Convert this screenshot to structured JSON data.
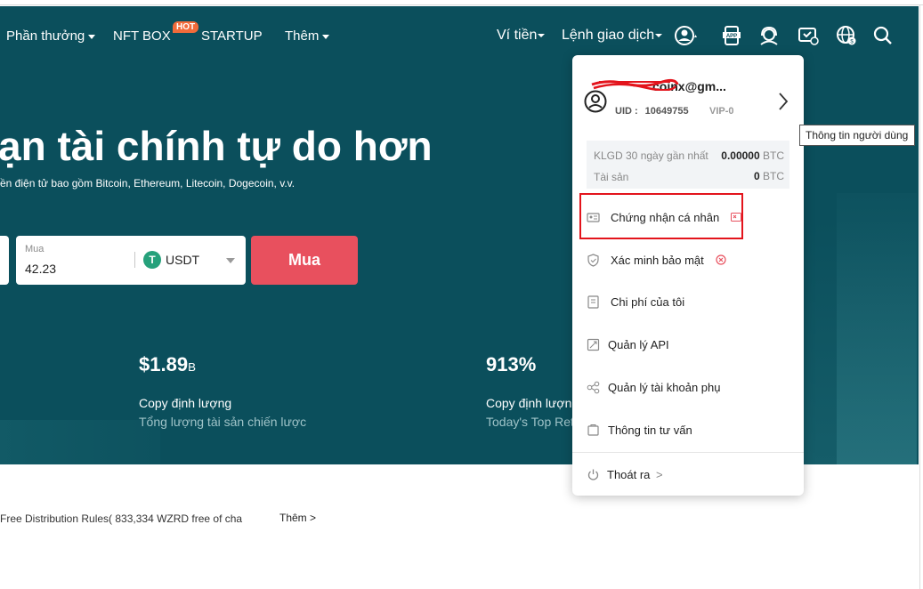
{
  "nav": {
    "rewards": "Phần thưởng",
    "nft_box": "NFT BOX",
    "hot_badge": "HOT",
    "startup": "STARTUP",
    "more": "Thêm",
    "wallet": "Ví tiền",
    "orders": "Lệnh giao dịch",
    "icons": [
      "user-icon",
      "app-icon",
      "support-icon",
      "fees-icon",
      "language-icon",
      "search-icon"
    ]
  },
  "hero": {
    "headline": "ạn tài chính tự do hơn",
    "subline": "ền điện tử bao gồm Bitcoin, Ethereum, Litecoin, Dogecoin, v.v.",
    "buy_label": "Mua",
    "buy_value": "42.23",
    "currency": "USDT",
    "buy_button": "Mua",
    "stats": [
      {
        "value": "$1.89",
        "unit": "B",
        "title": "Copy định lượng",
        "subtitle": "Tổng lượng tài sản chiến lược"
      },
      {
        "value": "913%",
        "unit": "",
        "title": "Copy định lượn",
        "subtitle": "Today's Top Ret"
      }
    ]
  },
  "below": {
    "rules": "Free Distribution Rules( 833,334 WZRD free of cha",
    "more": "Thêm >"
  },
  "dropdown": {
    "email": "coinx@gm...",
    "uid_label": "UID :",
    "uid_value": "10649755",
    "vip": "VIP-0",
    "volume_label": "KLGD 30 ngày gần nhất",
    "volume_value": "0.00000",
    "volume_unit": "BTC",
    "assets_label": "Tài sản",
    "assets_value": "0",
    "assets_unit": "BTC",
    "items": [
      {
        "label": "Chứng nhận cá nhân",
        "icon": "id-card-icon"
      },
      {
        "label": "Xác minh bảo mật",
        "icon": "shield-icon"
      },
      {
        "label": "Chi phí của tôi",
        "icon": "receipt-icon"
      },
      {
        "label": "Quản lý API",
        "icon": "api-icon"
      },
      {
        "label": "Quản lý tài khoản phụ",
        "icon": "sub-account-icon"
      },
      {
        "label": "Thông tin tư vấn",
        "icon": "message-icon"
      }
    ],
    "logout": "Thoát ra",
    "logout_arrow": ">"
  },
  "tooltip": "Thông tin người dùng",
  "colors": {
    "hero_bg": "#0b4f5c",
    "buy_button": "#e8505e",
    "highlight": "#e3141c",
    "usdt": "#26a17b"
  }
}
